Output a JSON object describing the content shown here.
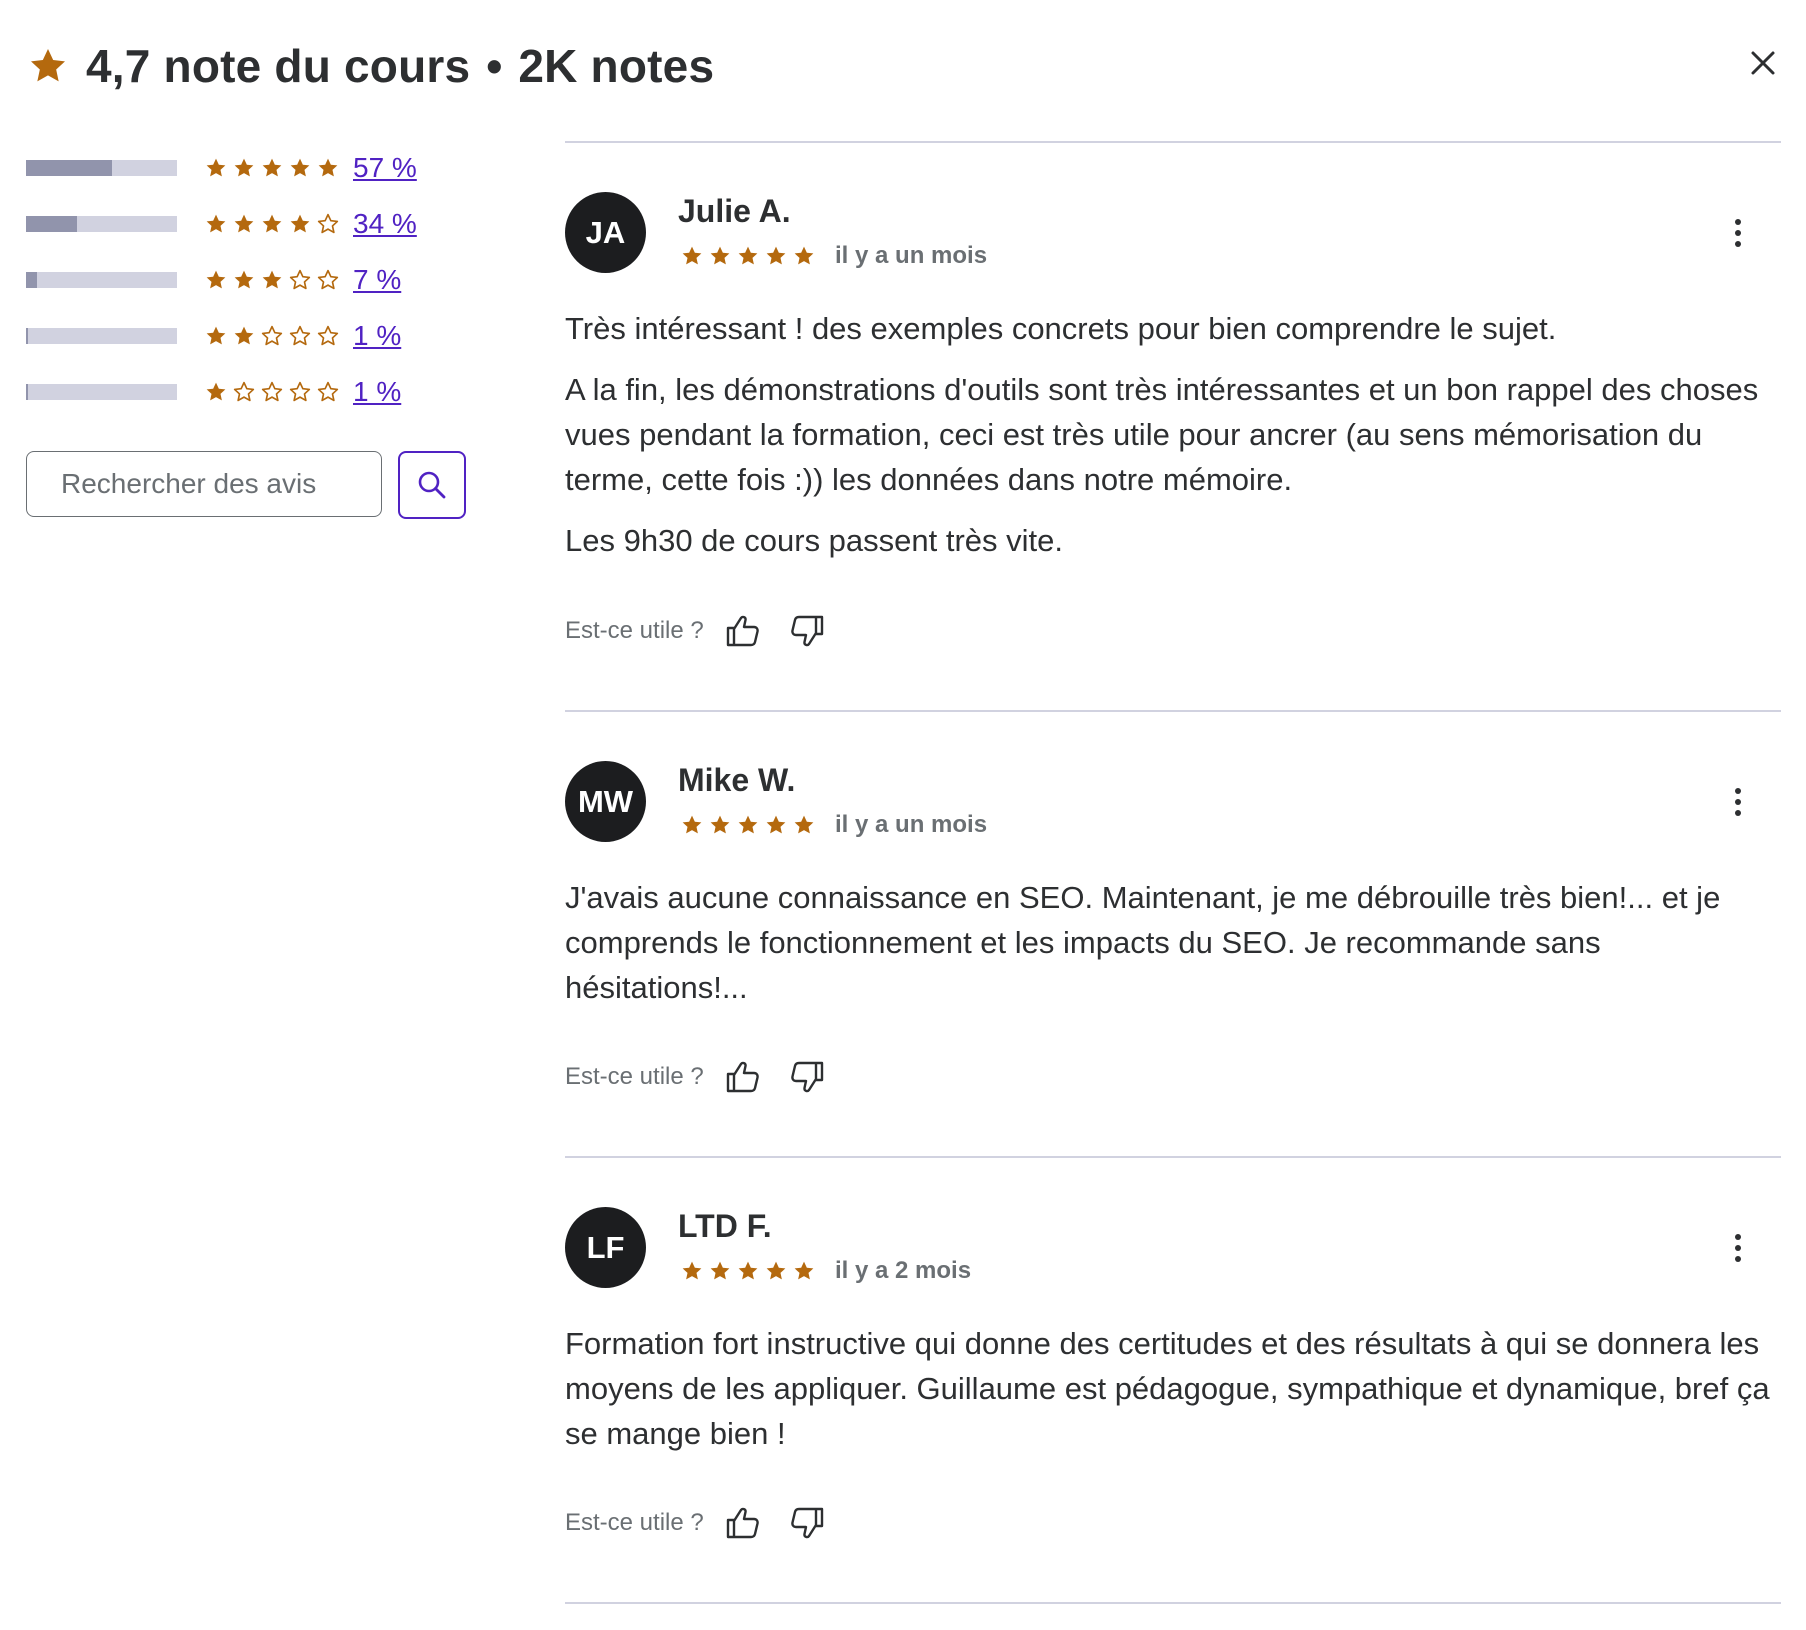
{
  "header": {
    "rating_title": "4,7 note du cours",
    "separator": "•",
    "count_title": "2K notes",
    "star_color": "#b4690e"
  },
  "breakdown": [
    {
      "stars": 5,
      "percent_label": "57 %",
      "fraction": 0.57
    },
    {
      "stars": 4,
      "percent_label": "34 %",
      "fraction": 0.34
    },
    {
      "stars": 3,
      "percent_label": "7 %",
      "fraction": 0.07
    },
    {
      "stars": 2,
      "percent_label": "1 %",
      "fraction": 0.01
    },
    {
      "stars": 1,
      "percent_label": "1 %",
      "fraction": 0.01
    }
  ],
  "search": {
    "placeholder": "Rechercher des avis"
  },
  "helpful_label": "Est-ce utile ?",
  "reviews": [
    {
      "initials": "JA",
      "name": "Julie A.",
      "rating": 5,
      "date": "il y a un mois",
      "paragraphs": [
        "Très intéressant ! des exemples concrets pour bien comprendre le sujet.",
        "A la fin, les démonstrations d'outils sont très intéressantes et un bon rappel des choses vues pendant la formation, ceci est très utile pour ancrer (au sens mémorisation du terme, cette fois :)) les données dans notre mémoire.",
        "Les 9h30 de cours passent très vite."
      ]
    },
    {
      "initials": "MW",
      "name": "Mike W.",
      "rating": 5,
      "date": "il y a un mois",
      "paragraphs": [
        "J'avais aucune connaissance en SEO. Maintenant, je me débrouille très bien!... et je comprends le fonctionnement et les impacts du SEO. Je recommande sans hésitations!..."
      ]
    },
    {
      "initials": "LF",
      "name": "LTD F.",
      "rating": 5,
      "date": "il y a 2 mois",
      "paragraphs": [
        "Formation fort instructive qui donne des certitudes et des résultats à qui se donnera les moyens de les appliquer. Guillaume est pédagogue, sympathique et dynamique, bref ça se mange bien !"
      ]
    }
  ]
}
